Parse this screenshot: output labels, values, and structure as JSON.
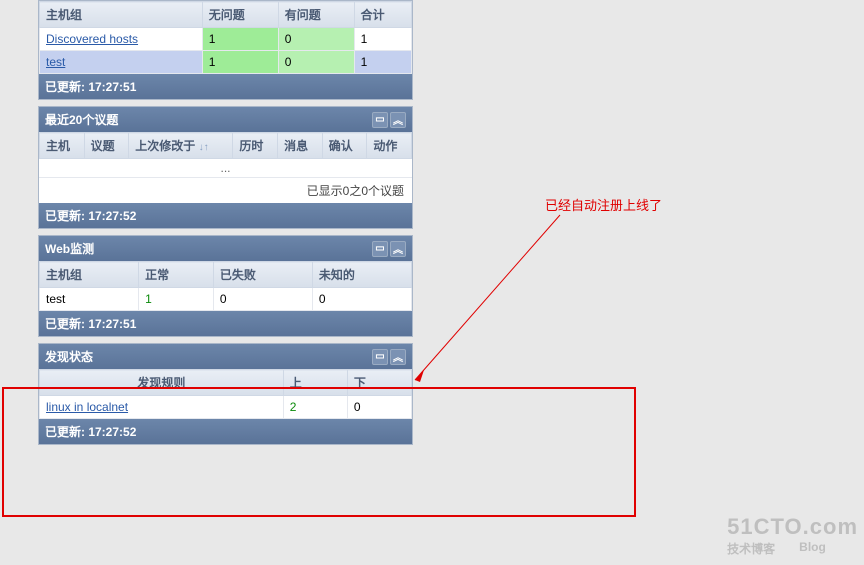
{
  "hostgroup": {
    "headers": [
      "主机组",
      "无问题",
      "有问题",
      "合计"
    ],
    "rows": [
      {
        "name": "Discovered hosts",
        "ok": "1",
        "bad": "0",
        "total": "1",
        "rowbg": "white"
      },
      {
        "name": "test",
        "ok": "1",
        "bad": "0",
        "total": "1",
        "rowbg": "blue"
      }
    ],
    "footer": "已更新: 17:27:51"
  },
  "issues": {
    "title": "最近20个议题",
    "headers": [
      "主机",
      "议题",
      "上次修改于",
      "历时",
      "消息",
      "确认",
      "动作"
    ],
    "shown": "已显示0之0个议题",
    "footer": "已更新: 17:27:52"
  },
  "webmon": {
    "title": "Web监测",
    "headers": [
      "主机组",
      "正常",
      "已失败",
      "未知的"
    ],
    "row": {
      "group": "test",
      "ok": "1",
      "fail": "0",
      "unknown": "0"
    },
    "footer": "已更新: 17:27:51"
  },
  "discovery": {
    "title": "发现状态",
    "headers": [
      "发现规则",
      "上",
      "下"
    ],
    "row": {
      "rule": "linux in localnet",
      "up": "2",
      "down": "0"
    },
    "footer": "已更新: 17:27:52"
  },
  "annotation": "已经自动注册上线了",
  "watermark": {
    "big": "51CTO.com",
    "sub1": "技术博客",
    "sub2": "Blog"
  }
}
